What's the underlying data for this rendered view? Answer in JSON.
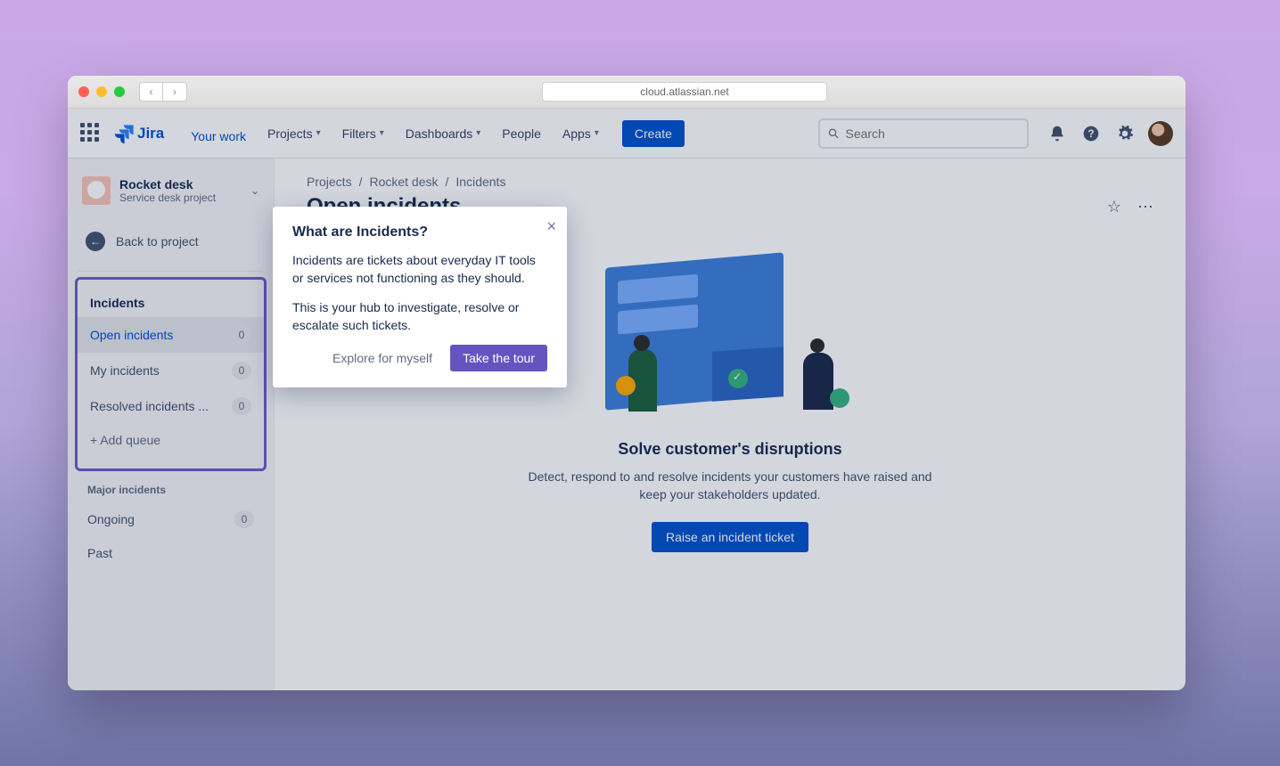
{
  "browser": {
    "url": "cloud.atlassian.net"
  },
  "nav": {
    "logo_text": "Jira",
    "items": [
      {
        "label": "Your work",
        "active": true,
        "chevron": false
      },
      {
        "label": "Projects",
        "active": false,
        "chevron": true
      },
      {
        "label": "Filters",
        "active": false,
        "chevron": true
      },
      {
        "label": "Dashboards",
        "active": false,
        "chevron": true
      },
      {
        "label": "People",
        "active": false,
        "chevron": false
      },
      {
        "label": "Apps",
        "active": false,
        "chevron": true
      }
    ],
    "create_label": "Create",
    "search_placeholder": "Search"
  },
  "sidebar": {
    "project_name": "Rocket desk",
    "project_type": "Service desk project",
    "back_label": "Back to project",
    "section_incidents": "Incidents",
    "queues": [
      {
        "label": "Open incidents",
        "count": "0",
        "active": true
      },
      {
        "label": "My incidents",
        "count": "0",
        "active": false
      },
      {
        "label": "Resolved incidents ...",
        "count": "0",
        "active": false
      }
    ],
    "add_queue_label": "+ Add queue",
    "section_major": "Major incidents",
    "major_items": [
      {
        "label": "Ongoing",
        "count": "0"
      },
      {
        "label": "Past",
        "count": null
      }
    ]
  },
  "breadcrumb": [
    "Projects",
    "Rocket desk",
    "Incidents"
  ],
  "page_title": "Open incidents",
  "empty": {
    "heading": "Solve customer's disruptions",
    "desc": "Detect, respond to and resolve incidents your customers have raised and keep your stakeholders updated.",
    "cta": "Raise an incident ticket"
  },
  "popover": {
    "title": "What are Incidents?",
    "p1": "Incidents are tickets about everyday IT tools or services not functioning as they should.",
    "p2": "This is your hub to investigate, resolve or escalate such tickets.",
    "explore": "Explore for myself",
    "tour": "Take the tour"
  }
}
